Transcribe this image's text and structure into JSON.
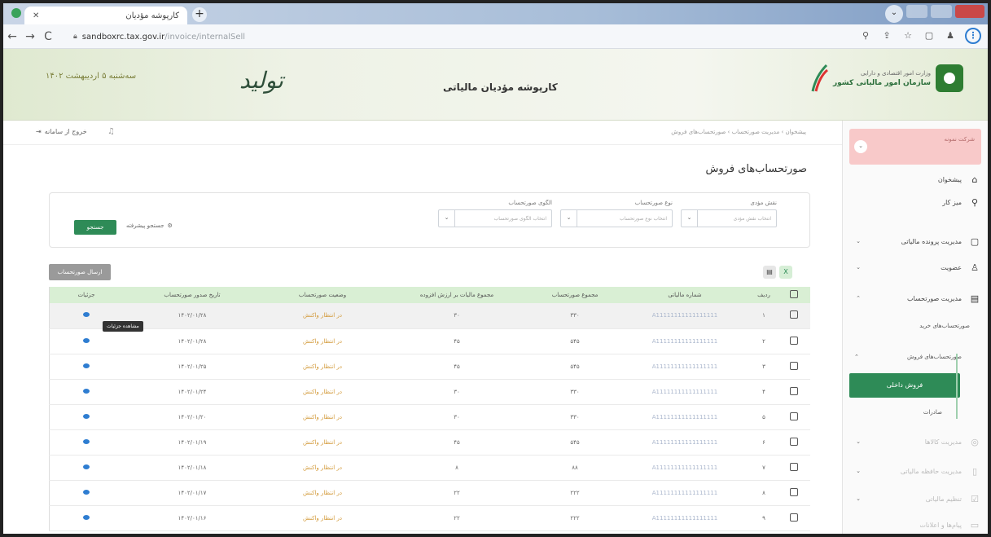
{
  "browser": {
    "tab_title": "کارپوشه مؤدیان",
    "tab_close": "✕",
    "new_tab": "+",
    "url_host": "sandboxrc.tax.gov.ir",
    "url_path": "/invoice/internalSell"
  },
  "header": {
    "date": "سه‌شنبه ۵ اردیبهشت ۱۴۰۲",
    "title": "کارپوشه مؤدیان مالیاتی",
    "logo_text": "تولید",
    "org_line1": "وزارت امور اقتصادی و دارایی",
    "org_line2": "سازمان امور مالیاتی کشور"
  },
  "toprow": {
    "logout": "خروج از سامانه",
    "breadcrumb": "پیشخوان › مدیریت صورتحساب › صورتحساب‌های فروش"
  },
  "page": {
    "title": "صورتحساب‌های فروش"
  },
  "filters": [
    {
      "label": "نقش مؤدی",
      "placeholder": "انتخاب نقش مؤدی"
    },
    {
      "label": "نوع صورتحساب",
      "placeholder": "انتخاب نوع صورتحساب"
    },
    {
      "label": "الگوی صورتحساب",
      "placeholder": "انتخاب الگوی صورتحساب"
    }
  ],
  "buttons": {
    "search": "جستجو",
    "advanced_search": "جستجو پیشرفته",
    "send": "ارسال صورتحساب"
  },
  "table": {
    "headers": [
      "ردیف",
      "شماره مالیاتی",
      "مجموع صورتحساب",
      "مجموع مالیات بر ارزش افزوده",
      "وضعیت صورتحساب",
      "تاریخ صدور صورتحساب",
      "جزئیات"
    ],
    "tooltip": "مشاهده جزئیات",
    "rows": [
      {
        "idx": "۱",
        "tax_no": "A11111111111111111",
        "total": "۳۳۰",
        "vat": "۳۰",
        "status": "در انتظار واکنش",
        "date": "۱۴۰۲/۰۱/۲۸"
      },
      {
        "idx": "۲",
        "tax_no": "A11111111111111111",
        "total": "۵۴۵",
        "vat": "۴۵",
        "status": "در انتظار واکنش",
        "date": "۱۴۰۲/۰۱/۲۸"
      },
      {
        "idx": "۳",
        "tax_no": "A11111111111111111",
        "total": "۵۴۵",
        "vat": "۴۵",
        "status": "در انتظار واکنش",
        "date": "۱۴۰۲/۰۱/۲۵"
      },
      {
        "idx": "۴",
        "tax_no": "A11111111111111111",
        "total": "۳۳۰",
        "vat": "۳۰",
        "status": "در انتظار واکنش",
        "date": "۱۴۰۲/۰۱/۲۴"
      },
      {
        "idx": "۵",
        "tax_no": "A11111111111111111",
        "total": "۳۳۰",
        "vat": "۳۰",
        "status": "در انتظار واکنش",
        "date": "۱۴۰۲/۰۱/۲۰"
      },
      {
        "idx": "۶",
        "tax_no": "A11111111111111111",
        "total": "۵۴۵",
        "vat": "۴۵",
        "status": "در انتظار واکنش",
        "date": "۱۴۰۲/۰۱/۱۹"
      },
      {
        "idx": "۷",
        "tax_no": "A11111111111111111",
        "total": "۸۸",
        "vat": "۸",
        "status": "در انتظار واکنش",
        "date": "۱۴۰۲/۰۱/۱۸"
      },
      {
        "idx": "۸",
        "tax_no": "A11111111111111111",
        "total": "۲۲۲",
        "vat": "۲۲",
        "status": "در انتظار واکنش",
        "date": "۱۴۰۲/۰۱/۱۷"
      },
      {
        "idx": "۹",
        "tax_no": "A11111111111111111",
        "total": "۲۲۲",
        "vat": "۲۲",
        "status": "در انتظار واکنش",
        "date": "۱۴۰۲/۰۱/۱۶"
      }
    ]
  },
  "sidebar": {
    "user": "شرکت نمونه",
    "items": [
      {
        "label": "پیشخوان",
        "icon": "⌂"
      },
      {
        "label": "میز کار",
        "icon": "⚲"
      },
      {
        "label": "مدیریت پرونده مالیاتی",
        "icon": "▢"
      },
      {
        "label": "عضویت",
        "icon": "♙"
      },
      {
        "label": "مدیریت صورتحساب",
        "icon": "▤"
      }
    ],
    "sub_buy": "صورتحساب‌های خرید",
    "sub_sell": "صورتحساب‌های فروش",
    "active": "فروش داخلی",
    "sub_export": "صادرات",
    "faded_items": [
      {
        "label": "مدیریت کالاها",
        "icon": "◎"
      },
      {
        "label": "مدیریت حافظه مالیاتی",
        "icon": "▯"
      },
      {
        "label": "تنظیم مالیاتی",
        "icon": "☑"
      },
      {
        "label": "پیام‌ها و اعلانات",
        "icon": "▭"
      }
    ]
  }
}
